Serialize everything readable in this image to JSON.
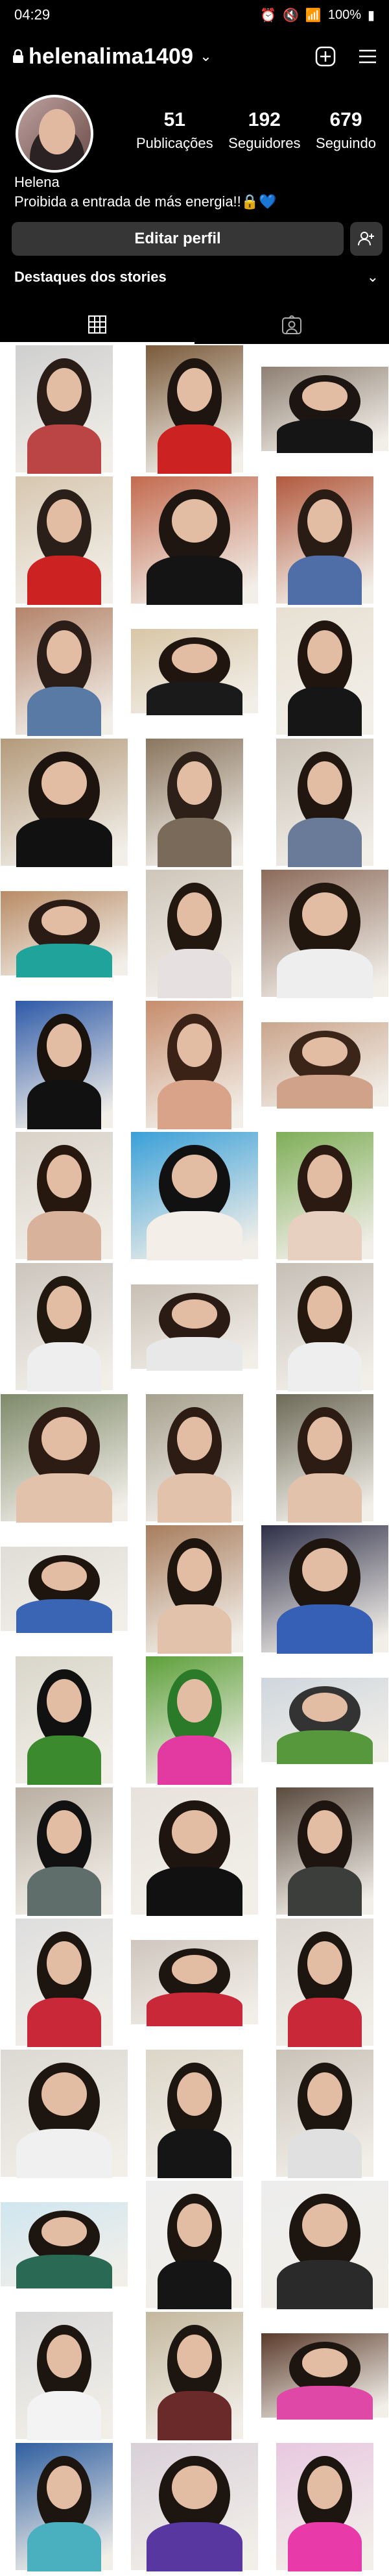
{
  "status_bar": {
    "time": "04:29",
    "battery": "100%"
  },
  "header": {
    "username": "helenalima1409"
  },
  "profile": {
    "posts": "51",
    "posts_label": "Publicações",
    "followers": "192",
    "followers_label": "Seguidores",
    "following": "679",
    "following_label": "Seguindo",
    "name": "Helena",
    "bio": "Proibida a entrada de más energia!!🔒💙",
    "edit_button": "Editar perfil",
    "stories_label": "Destaques dos stories"
  },
  "grid": {
    "posts": [
      {
        "bg": "#cfcfcf",
        "tone": "#b44",
        "hair": "#2a1d17"
      },
      {
        "bg": "#7a5a3a",
        "tone": "#c22",
        "hair": "#1e1410"
      },
      {
        "bg": "#8e7f72",
        "tone": "#151515",
        "hair": "#1c1511"
      },
      {
        "bg": "#d7c7b0",
        "tone": "#c22",
        "hair": "#2a1f19"
      },
      {
        "bg": "#c36b4f",
        "tone": "#141414",
        "hair": "#1f1611"
      },
      {
        "bg": "#b25a3e",
        "tone": "#4f6ea8",
        "hair": "#281c15"
      },
      {
        "bg": "#b4846a",
        "tone": "#5a7aa6",
        "hair": "#2b1e18"
      },
      {
        "bg": "#d8c6a6",
        "tone": "#1a1a1a",
        "hair": "#21160f"
      },
      {
        "bg": "#e8e0d3",
        "tone": "#161616",
        "hair": "#20150f"
      },
      {
        "bg": "#b49a7a",
        "tone": "#111",
        "hair": "#1d140f"
      },
      {
        "bg": "#8a765f",
        "tone": "#7a6a5a",
        "hair": "#2c2019"
      },
      {
        "bg": "#c9c0b4",
        "tone": "#6a7b9a",
        "hair": "#211710"
      },
      {
        "bg": "#b98b65",
        "tone": "#1fa39b",
        "hair": "#2a1c15"
      },
      {
        "bg": "#cfc6ba",
        "tone": "#e6e0e0",
        "hair": "#23180f"
      },
      {
        "bg": "#8c6b5a",
        "tone": "#eee",
        "hair": "#22170f"
      },
      {
        "bg": "#2e5aa8",
        "tone": "#111",
        "hair": "#1a120d"
      },
      {
        "bg": "#c78d6d",
        "tone": "#d9a38a",
        "hair": "#3a2216"
      },
      {
        "bg": "#caa58c",
        "tone": "#d0a28a",
        "hair": "#3b2418"
      },
      {
        "bg": "#d8d2c8",
        "tone": "#d9b29b",
        "hair": "#26180f"
      },
      {
        "bg": "#3aa0d8",
        "tone": "#f3efe8",
        "hair": "#111"
      },
      {
        "bg": "#7fae58",
        "tone": "#e8d0c0",
        "hair": "#2a1a12"
      },
      {
        "bg": "#cbc5bd",
        "tone": "#eee",
        "hair": "#211810"
      },
      {
        "bg": "#c8bfb4",
        "tone": "#e8e8e8",
        "hair": "#2a1c15"
      },
      {
        "bg": "#c6bfb6",
        "tone": "#eee",
        "hair": "#25190f"
      },
      {
        "bg": "#7f8a6a",
        "tone": "#e2c2ab",
        "hair": "#2c1c14"
      },
      {
        "bg": "#a6a08e",
        "tone": "#e2c2ab",
        "hair": "#2c1c14"
      },
      {
        "bg": "#6d6a58",
        "tone": "#e2c2ab",
        "hair": "#2c1c14"
      },
      {
        "bg": "#e0ddd6",
        "tone": "#3a65b4",
        "hair": "#1f150f"
      },
      {
        "bg": "#a87d5d",
        "tone": "#e2c2ab",
        "hair": "#1f150f"
      },
      {
        "bg": "#2e2f48",
        "tone": "#3660b6",
        "hair": "#1f150f"
      },
      {
        "bg": "#d9d6ca",
        "tone": "#3c8a2e",
        "hair": "#111"
      },
      {
        "bg": "#5da03a",
        "tone": "#e23aa0",
        "hair": "#2b7a2a"
      },
      {
        "bg": "#cfd6dd",
        "tone": "#58983c",
        "hair": "#333"
      },
      {
        "bg": "#b9aea1",
        "tone": "#5f6d6b",
        "hair": "#111"
      },
      {
        "bg": "#e8e2dc",
        "tone": "#111",
        "hair": "#1f1510"
      },
      {
        "bg": "#5a4a3e",
        "tone": "#3b3e3a",
        "hair": "#1f1510"
      },
      {
        "bg": "#dedede",
        "tone": "#c82838",
        "hair": "#1d1510"
      },
      {
        "bg": "#cfc6be",
        "tone": "#c82838",
        "hair": "#1d1510"
      },
      {
        "bg": "#dcd6d0",
        "tone": "#c82838",
        "hair": "#1d1510"
      },
      {
        "bg": "#dcd8d2",
        "tone": "#f0f0f0",
        "hair": "#1d1510"
      },
      {
        "bg": "#dcd6c8",
        "tone": "#151515",
        "hair": "#1d1510"
      },
      {
        "bg": "#c9c2b8",
        "tone": "#e0e0e0",
        "hair": "#1d1510"
      },
      {
        "bg": "#cfe6f0",
        "tone": "#2a6a55",
        "hair": "#1d1510"
      },
      {
        "bg": "#eeeeee",
        "tone": "#151515",
        "hair": "#1d1510"
      },
      {
        "bg": "#ededed",
        "tone": "#2a2a2a",
        "hair": "#1d1510"
      },
      {
        "bg": "#d8d8d8",
        "tone": "#f3f3f3",
        "hair": "#1d1510"
      },
      {
        "bg": "#c4b89e",
        "tone": "#6a2a2a",
        "hair": "#1d1510"
      },
      {
        "bg": "#5a3a2a",
        "tone": "#e048a8",
        "hair": "#1d1510"
      },
      {
        "bg": "#2f5fa0",
        "tone": "#4ab0c0",
        "hair": "#1d1510"
      },
      {
        "bg": "#d8d0d8",
        "tone": "#5838a0",
        "hair": "#1d1510"
      },
      {
        "bg": "#e8c8e0",
        "tone": "#e83aa8",
        "hair": "#1d1510"
      }
    ]
  }
}
